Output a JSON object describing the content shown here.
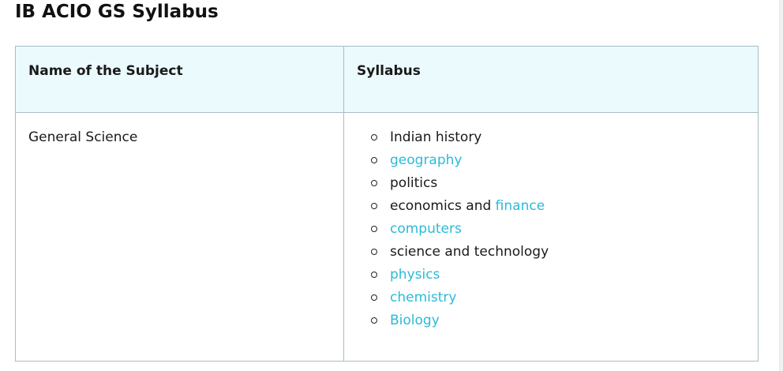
{
  "page": {
    "title": "IB ACIO GS Syllabus"
  },
  "table": {
    "headers": {
      "subject": "Name of the Subject",
      "syllabus": "Syllabus"
    },
    "rows": [
      {
        "subject": "General Science",
        "topics": [
          {
            "text": "Indian history",
            "is_link": false
          },
          {
            "text": "geography",
            "is_link": true
          },
          {
            "text": "politics",
            "is_link": false
          },
          {
            "text": "economics and ",
            "link": "finance"
          },
          {
            "text": "computers",
            "is_link": true
          },
          {
            "text": "science and technology",
            "is_link": false
          },
          {
            "text": "physics",
            "is_link": true
          },
          {
            "text": "chemistry",
            "is_link": true
          },
          {
            "text": "Biology",
            "is_link": true
          }
        ]
      }
    ]
  },
  "colors": {
    "link": "#2bbad8",
    "header_bg": "#ebfafd",
    "border": "#a9bcc5"
  }
}
